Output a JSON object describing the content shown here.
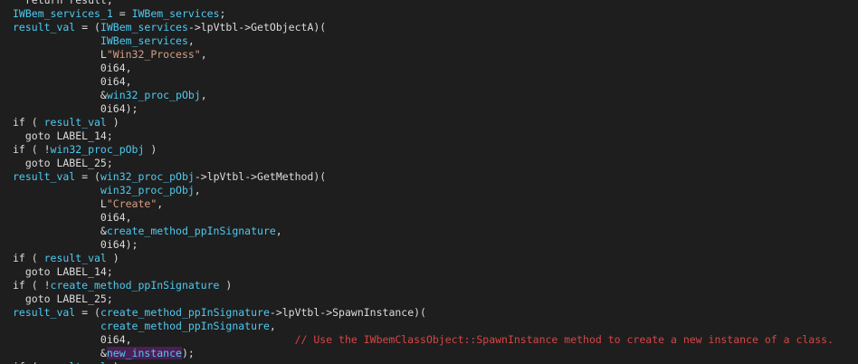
{
  "colors": {
    "background": "#1e1e1e",
    "text": "#dcdcdc",
    "identifier": "#4ec9f0",
    "string": "#d69d85",
    "comment": "#d64545",
    "highlight": "#4b1e55"
  },
  "lines": [
    [
      {
        "t": "  return result;"
      }
    ],
    [
      {
        "t": "IWBem_services_1",
        "c": "var"
      },
      {
        "t": " = "
      },
      {
        "t": "IWBem_services",
        "c": "var"
      },
      {
        "t": ";"
      }
    ],
    [
      {
        "t": "result_val",
        "c": "var"
      },
      {
        "t": " = ("
      },
      {
        "t": "IWBem_services",
        "c": "var"
      },
      {
        "t": "->lpVtbl->GetObjectA)("
      }
    ],
    [
      {
        "t": "              "
      },
      {
        "t": "IWBem_services",
        "c": "var"
      },
      {
        "t": ","
      }
    ],
    [
      {
        "t": "              L"
      },
      {
        "t": "\"Win32_Process\"",
        "c": "str"
      },
      {
        "t": ","
      }
    ],
    [
      {
        "t": "              0i64,"
      }
    ],
    [
      {
        "t": "              0i64,"
      }
    ],
    [
      {
        "t": "              &"
      },
      {
        "t": "win32_proc_pObj",
        "c": "var"
      },
      {
        "t": ","
      }
    ],
    [
      {
        "t": "              0i64);"
      }
    ],
    [
      {
        "t": "if ( "
      },
      {
        "t": "result_val",
        "c": "var"
      },
      {
        "t": " )"
      }
    ],
    [
      {
        "t": "  goto LABEL_14;"
      }
    ],
    [
      {
        "t": "if ( !"
      },
      {
        "t": "win32_proc_pObj",
        "c": "var"
      },
      {
        "t": " )"
      }
    ],
    [
      {
        "t": "  goto LABEL_25;"
      }
    ],
    [
      {
        "t": "result_val",
        "c": "var"
      },
      {
        "t": " = ("
      },
      {
        "t": "win32_proc_pObj",
        "c": "var"
      },
      {
        "t": "->lpVtbl->GetMethod)("
      }
    ],
    [
      {
        "t": "              "
      },
      {
        "t": "win32_proc_pObj",
        "c": "var"
      },
      {
        "t": ","
      }
    ],
    [
      {
        "t": "              L"
      },
      {
        "t": "\"Create\"",
        "c": "str"
      },
      {
        "t": ","
      }
    ],
    [
      {
        "t": "              0i64,"
      }
    ],
    [
      {
        "t": "              &"
      },
      {
        "t": "create_method_ppInSignature",
        "c": "var"
      },
      {
        "t": ","
      }
    ],
    [
      {
        "t": "              0i64);"
      }
    ],
    [
      {
        "t": "if ( "
      },
      {
        "t": "result_val",
        "c": "var"
      },
      {
        "t": " )"
      }
    ],
    [
      {
        "t": "  goto LABEL_14;"
      }
    ],
    [
      {
        "t": "if ( !"
      },
      {
        "t": "create_method_ppInSignature",
        "c": "var"
      },
      {
        "t": " )"
      }
    ],
    [
      {
        "t": "  goto LABEL_25;"
      }
    ],
    [
      {
        "t": "result_val",
        "c": "var"
      },
      {
        "t": " = ("
      },
      {
        "t": "create_method_ppInSignature",
        "c": "var"
      },
      {
        "t": "->lpVtbl->SpawnInstance)("
      }
    ],
    [
      {
        "t": "              "
      },
      {
        "t": "create_method_ppInSignature",
        "c": "var"
      },
      {
        "t": ","
      }
    ],
    [
      {
        "t": "              0i64,                          "
      },
      {
        "t": "// Use the IWbemClassObject::SpawnInstance method to create a new instance of a class.",
        "c": "cmt"
      }
    ],
    [
      {
        "t": "              &"
      },
      {
        "t": "new_instance",
        "c": "hl"
      },
      {
        "t": ");"
      }
    ],
    [
      {
        "t": "if ( "
      },
      {
        "t": "result_val",
        "c": "var"
      },
      {
        "t": " )"
      }
    ]
  ]
}
